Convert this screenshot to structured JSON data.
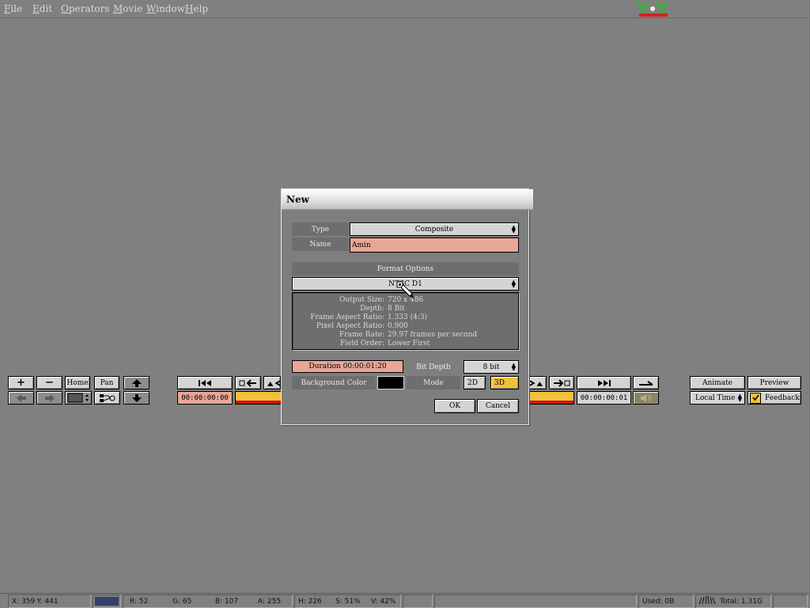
{
  "menu": {
    "items": [
      {
        "key": "F",
        "rest": "ile"
      },
      {
        "key": "E",
        "rest": "dit"
      },
      {
        "key": "O",
        "rest": "perators"
      },
      {
        "key": "M",
        "rest": "ovie"
      },
      {
        "key": "W",
        "rest": "indow"
      },
      {
        "key": "H",
        "rest": "elp"
      }
    ]
  },
  "left_panel": {
    "zoom_in": "+",
    "zoom_out": "−",
    "home": "Home",
    "pan": "Pan"
  },
  "transport": {
    "current_time": "00:00:00:00",
    "end_time": "00:00:00:01"
  },
  "right_panel": {
    "animate": "Animate",
    "preview": "Preview",
    "time_mode": "Local Time",
    "feedback": "Feedback"
  },
  "dialog": {
    "title": "New",
    "type_label": "Type",
    "type_value": "Composite",
    "name_label": "Name",
    "name_value": "Amin",
    "format_options_label": "Format Options",
    "format_value": "NTSC D1",
    "info": [
      {
        "k": "Output Size:",
        "v": "720 x 486"
      },
      {
        "k": "Depth:",
        "v": "8 Bit"
      },
      {
        "k": "Frame Aspect Ratio:",
        "v": "1.333  (4:3)"
      },
      {
        "k": "Pixel Aspect Ratio:",
        "v": "0.900"
      },
      {
        "k": "Frame Rate:",
        "v": "29.97 frames per second"
      },
      {
        "k": "Field Order:",
        "v": "Lower First"
      }
    ],
    "duration": "Duration 00:00:01:20",
    "bit_depth_label": "Bit Depth",
    "bit_depth_value": "8 bit",
    "background_color_label": "Background Color",
    "background_color": "#000000",
    "mode_label": "Mode",
    "mode_2d": "2D",
    "mode_3d": "3D",
    "ok": "OK",
    "cancel": "Cancel"
  },
  "status": {
    "x": "X:   359",
    "y": "Y:   441",
    "r": "R: 52",
    "g": "G: 65",
    "b": "B: 107",
    "a": "A: 255",
    "h": "H: 226",
    "s": "S: 51%",
    "v": "V: 42%",
    "swatch_color": "#34416b",
    "used": "Used: 0B",
    "total": "Total: 1.31G"
  },
  "colors": {
    "accent_timecode": "#e9a696",
    "timeline_yellow": "#f0c23a",
    "timeline_red": "#d81010",
    "mode_active": "#f0c23a"
  }
}
